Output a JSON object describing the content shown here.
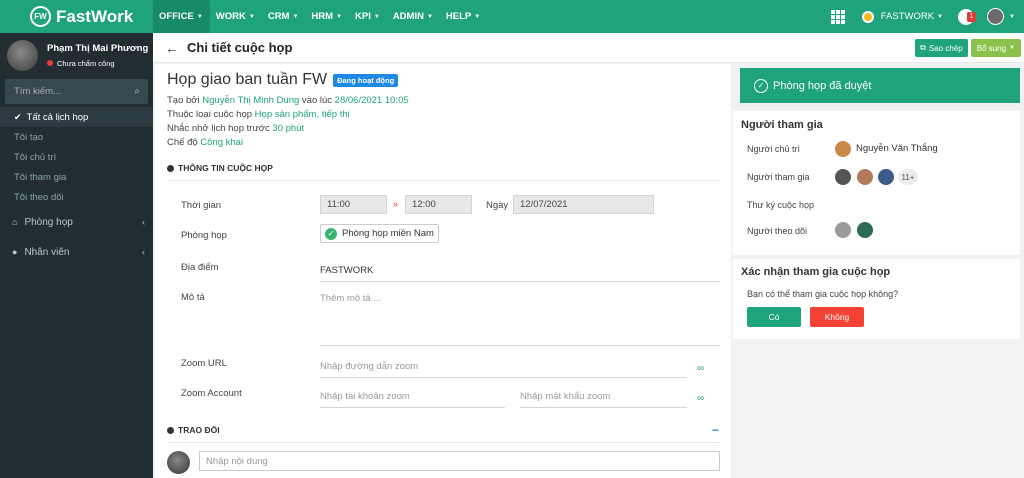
{
  "app": {
    "name": "FastWork",
    "logo_text": "FW"
  },
  "topnav": [
    {
      "label": "OFFICE"
    },
    {
      "label": "WORK"
    },
    {
      "label": "CRM"
    },
    {
      "label": "HRM"
    },
    {
      "label": "KPI"
    },
    {
      "label": "ADMIN"
    },
    {
      "label": "HELP"
    }
  ],
  "topright": {
    "org": "FASTWORK",
    "notif_count": "1"
  },
  "user": {
    "name": "Phạm Thị Mai Phương",
    "status": "Chưa chấm công"
  },
  "sidebar": {
    "search_placeholder": "Tìm kiếm...",
    "sub_items": [
      {
        "label": "Tất cả lịch họp"
      },
      {
        "label": "Tôi tạo"
      },
      {
        "label": "Tôi chủ trì"
      },
      {
        "label": "Tôi tham gia"
      },
      {
        "label": "Tôi theo dõi"
      }
    ],
    "menu": [
      {
        "label": "Phòng họp"
      },
      {
        "label": "Nhân viên"
      }
    ]
  },
  "header": {
    "title": "Chi tiết cuộc họp",
    "copy_label": "Sao chép",
    "more_label": "Bổ sung"
  },
  "meeting": {
    "title": "Họp giao ban tuần FW",
    "status": "Đang hoạt động",
    "created_prefix": "Tạo bởi",
    "created_by": "Nguyễn Thị Minh Dung",
    "created_mid": "vào lúc",
    "created_at": "28/06/2021 10:05",
    "type_prefix": "Thuộc loại cuộc họp",
    "type": "Họp sản phẩm, tiếp thị",
    "remind_prefix": "Nhắc nhở lịch họp trước",
    "remind": "30 phút",
    "mode_prefix": "Chế độ",
    "mode": "Công khai"
  },
  "info": {
    "section_title": "THÔNG TIN CUỘC HỌP",
    "time_label": "Thời gian",
    "start": "11:00",
    "end": "12:00",
    "arrow": "»",
    "date_label": "Ngày",
    "date": "12/07/2021",
    "room_label": "Phòng họp",
    "room": "Phòng họp miền Nam",
    "location_label": "Địa điểm",
    "location": "FASTWORK",
    "desc_label": "Mô tả",
    "desc_placeholder": "Thêm mô tả ...",
    "zoom_url_label": "Zoom URL",
    "zoom_url_placeholder": "Nhập đường dẫn zoom",
    "zoom_acc_label": "Zoom Account",
    "zoom_acc_placeholder": "Nhập tài khoản zoom",
    "zoom_pass_placeholder": "Nhập mật khẩu zoom"
  },
  "discussion": {
    "title": "TRAO ĐỔI",
    "placeholder": "Nhập nội dung",
    "collapse": "−"
  },
  "approval": {
    "label": "Phòng họp đã duyệt"
  },
  "participants": {
    "title": "Người tham gia",
    "host_label": "Người chủ trì",
    "host_name": "Nguyễn Văn Thắng",
    "attendees_label": "Người tham gia",
    "attendees_more": "11+",
    "secretary_label": "Thư ký cuộc họp",
    "followers_label": "Người theo dõi"
  },
  "confirm": {
    "title": "Xác nhận tham gia cuộc họp",
    "question": "Bạn có thể tham gia cuộc họp không?",
    "yes": "Có",
    "no": "Không"
  }
}
